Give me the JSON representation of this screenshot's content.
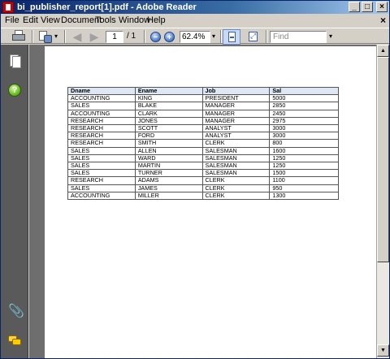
{
  "window": {
    "title": "bi_publisher_report[1].pdf - Adobe Reader",
    "min_label": "_",
    "max_label": "□",
    "close_label": "×"
  },
  "menu": {
    "items": [
      "File",
      "Edit",
      "View",
      "Document",
      "Tools",
      "Window",
      "Help"
    ],
    "doc_close": "×"
  },
  "toolbar": {
    "page_current": "1",
    "page_total": "/ 1",
    "zoom": "62.4%",
    "find_placeholder": "Find",
    "dropdown_glyph": "▾",
    "prev_glyph": "◀",
    "next_glyph": "▶"
  },
  "nav": {
    "help_glyph": "?",
    "attach_glyph": "📎"
  },
  "report": {
    "headers": [
      "Dname",
      "Ename",
      "Job",
      "Sal"
    ],
    "rows": [
      [
        "ACCOUNTING",
        "KING",
        "PRESIDENT",
        "5000"
      ],
      [
        "SALES",
        "BLAKE",
        "MANAGER",
        "2850"
      ],
      [
        "ACCOUNTING",
        "CLARK",
        "MANAGER",
        "2450"
      ],
      [
        "RESEARCH",
        "JONES",
        "MANAGER",
        "2975"
      ],
      [
        "RESEARCH",
        "SCOTT",
        "ANALYST",
        "3000"
      ],
      [
        "RESEARCH",
        "FORD",
        "ANALYST",
        "3000"
      ],
      [
        "RESEARCH",
        "SMITH",
        "CLERK",
        "800"
      ],
      [
        "SALES",
        "ALLEN",
        "SALESMAN",
        "1600"
      ],
      [
        "SALES",
        "WARD",
        "SALESMAN",
        "1250"
      ],
      [
        "SALES",
        "MARTIN",
        "SALESMAN",
        "1250"
      ],
      [
        "SALES",
        "TURNER",
        "SALESMAN",
        "1500"
      ],
      [
        "RESEARCH",
        "ADAMS",
        "CLERK",
        "1100"
      ],
      [
        "SALES",
        "JAMES",
        "CLERK",
        "950"
      ],
      [
        "ACCOUNTING",
        "MILLER",
        "CLERK",
        "1300"
      ]
    ]
  },
  "scrollbar": {
    "up_glyph": "▲",
    "down_glyph": "▼"
  }
}
